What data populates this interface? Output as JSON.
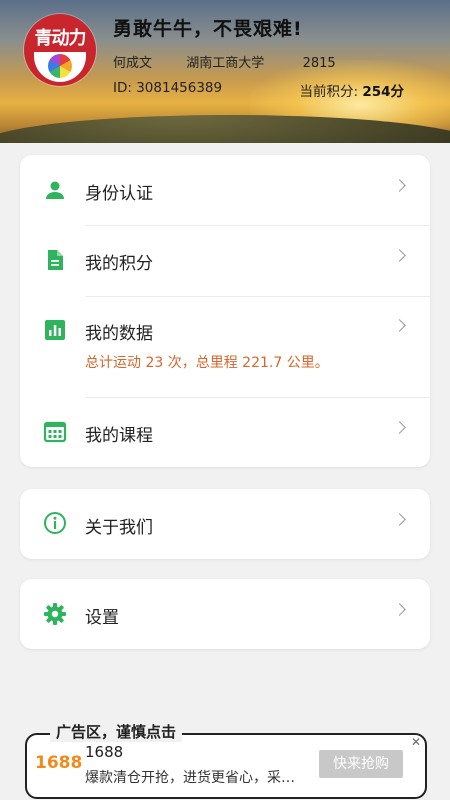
{
  "profile": {
    "app_logo_text": "青动力",
    "slogan": "勇敢牛牛，不畏艰难!",
    "name": "何成文",
    "school": "湖南工商大学",
    "number": "2815",
    "id_text": "ID:  3081456389",
    "points_label": "当前积分:",
    "points_value": "254分"
  },
  "menu": {
    "identity": "身份认证",
    "my_points": "我的积分",
    "my_data": "我的数据",
    "my_data_summary": "总计运动 23 次，总里程 221.7 公里。",
    "my_courses": "我的课程",
    "about_us": "关于我们",
    "settings": "设置"
  },
  "ad": {
    "tag": "广告区，谨慎点击",
    "logo": "1688",
    "title": "1688",
    "desc": "爆款清仓开抢，进货更省心，采购更划算",
    "button": "快来抢购",
    "close": "✕"
  },
  "colors": {
    "accent": "#2fb35d",
    "summary": "#d9652b"
  }
}
